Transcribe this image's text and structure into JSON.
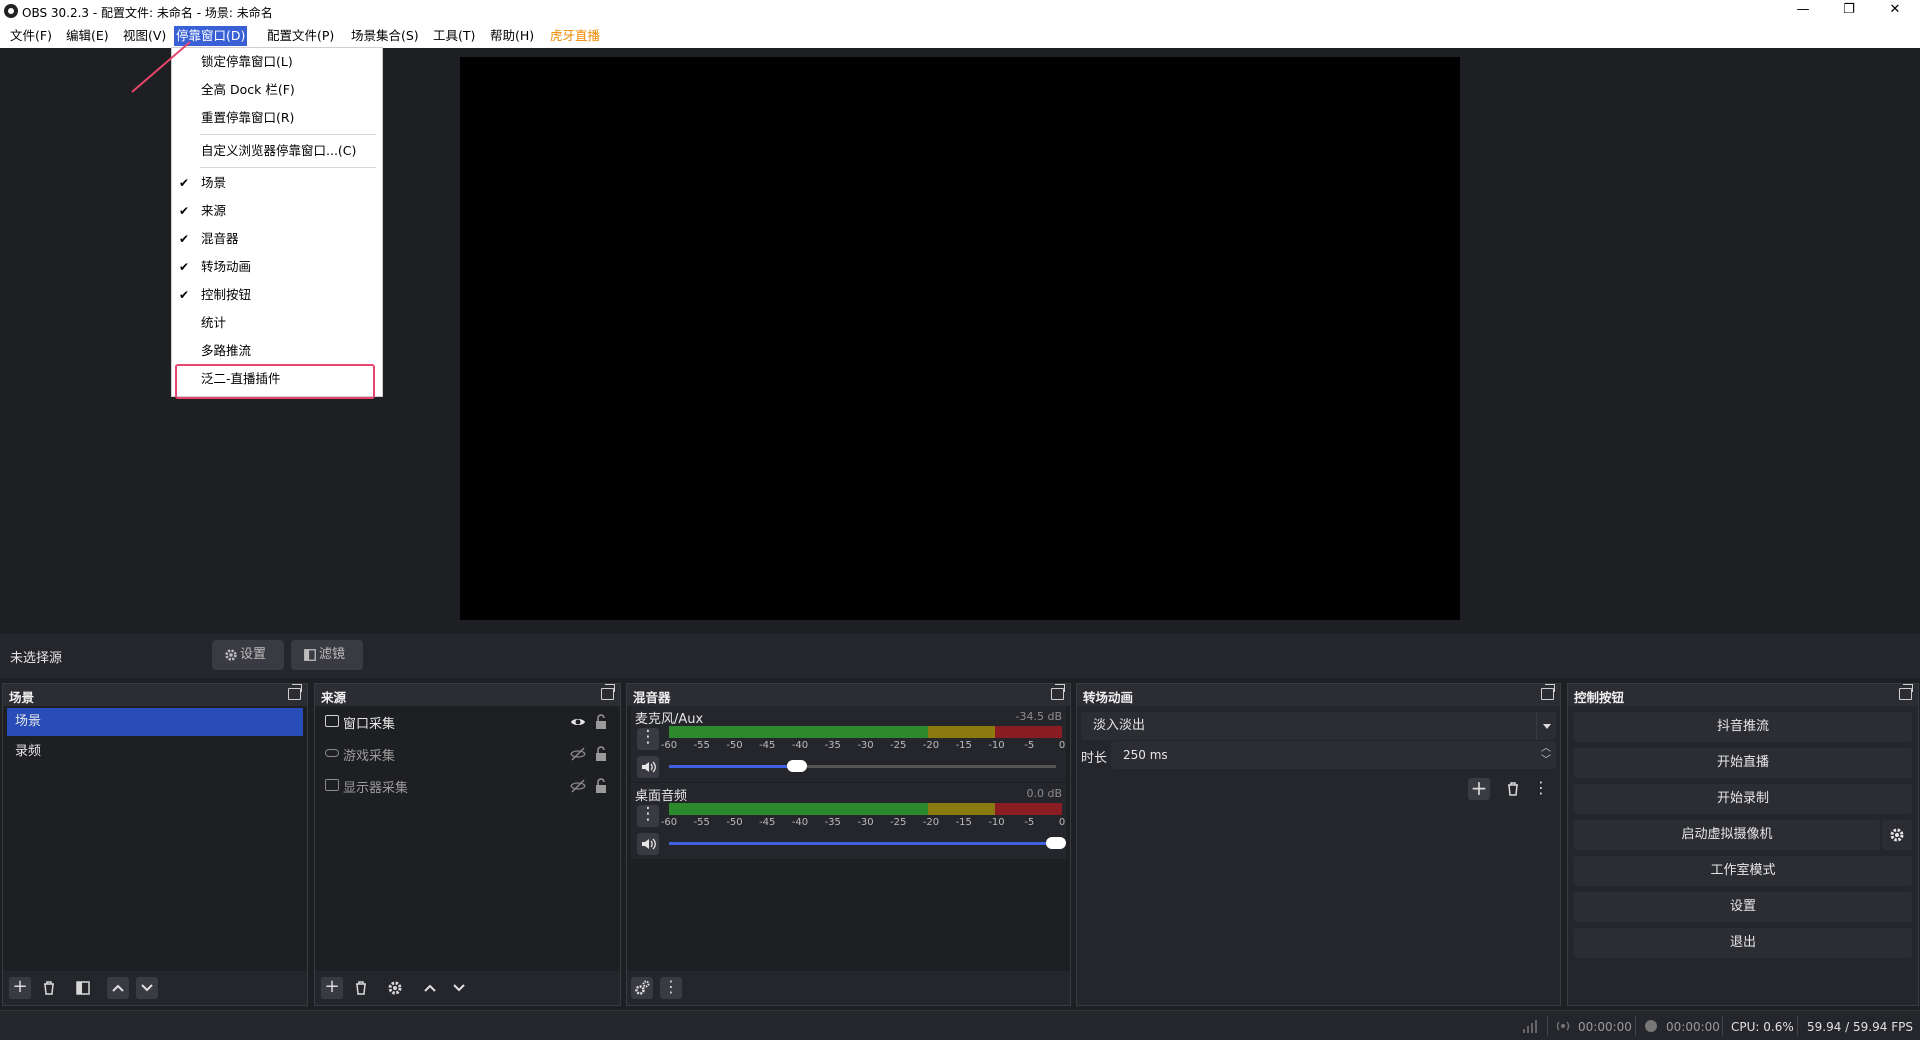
{
  "window": {
    "title": "OBS 30.2.3 - 配置文件: 未命名 - 场景: 未命名"
  },
  "menubar": {
    "items": [
      "文件(F)",
      "编辑(E)",
      "视图(V)",
      "停靠窗口(D)",
      "配置文件(P)",
      "场景集合(S)",
      "工具(T)",
      "帮助(H)",
      "虎牙直播"
    ]
  },
  "dock_menu": {
    "items": [
      {
        "label": "锁定停靠窗口(L)",
        "checked": false
      },
      {
        "label": "全高 Dock 栏(F)",
        "checked": false
      },
      {
        "label": "重置停靠窗口(R)",
        "checked": false
      },
      {
        "label": "自定义浏览器停靠窗口...(C)",
        "checked": false
      },
      {
        "label": "场景",
        "checked": true
      },
      {
        "label": "来源",
        "checked": true
      },
      {
        "label": "混音器",
        "checked": true
      },
      {
        "label": "转场动画",
        "checked": true
      },
      {
        "label": "控制按钮",
        "checked": true
      },
      {
        "label": "统计",
        "checked": false
      },
      {
        "label": "多路推流",
        "checked": false
      },
      {
        "label": "泛二-直播插件",
        "checked": false
      }
    ],
    "check_mark": "✔"
  },
  "sourcebar": {
    "no_source": "未选择源",
    "settings": "设置",
    "filters": "滤镜"
  },
  "scenes": {
    "title": "场景",
    "items": [
      "场景",
      "录频"
    ]
  },
  "sources": {
    "title": "来源",
    "items": [
      {
        "label": "窗口采集",
        "visible": true
      },
      {
        "label": "游戏采集",
        "visible": false
      },
      {
        "label": "显示器采集",
        "visible": false
      }
    ]
  },
  "mixer": {
    "title": "混音器",
    "ticks": [
      "-60",
      "-55",
      "-50",
      "-45",
      "-40",
      "-35",
      "-30",
      "-25",
      "-20",
      "-15",
      "-10",
      "-5",
      "0"
    ],
    "channels": [
      {
        "name": "麦克风/Aux",
        "db": "-34.5 dB",
        "volume": 0.33
      },
      {
        "name": "桌面音频",
        "db": "0.0 dB",
        "volume": 1.0
      }
    ]
  },
  "transitions": {
    "title": "转场动画",
    "selected": "淡入淡出",
    "duration_label": "时长",
    "duration_value": "250 ms"
  },
  "controls": {
    "title": "控制按钮",
    "buttons": [
      "抖音推流",
      "开始直播",
      "开始录制",
      "启动虚拟摄像机",
      "工作室模式",
      "设置",
      "退出"
    ]
  },
  "status": {
    "stream_time": "00:00:00",
    "rec_time": "00:00:00",
    "cpu": "CPU: 0.6%",
    "fps": "59.94 / 59.94 FPS"
  },
  "colors": {
    "accent": "#284cb8",
    "highlight": "#e8456c",
    "huya": "#f08a00"
  }
}
